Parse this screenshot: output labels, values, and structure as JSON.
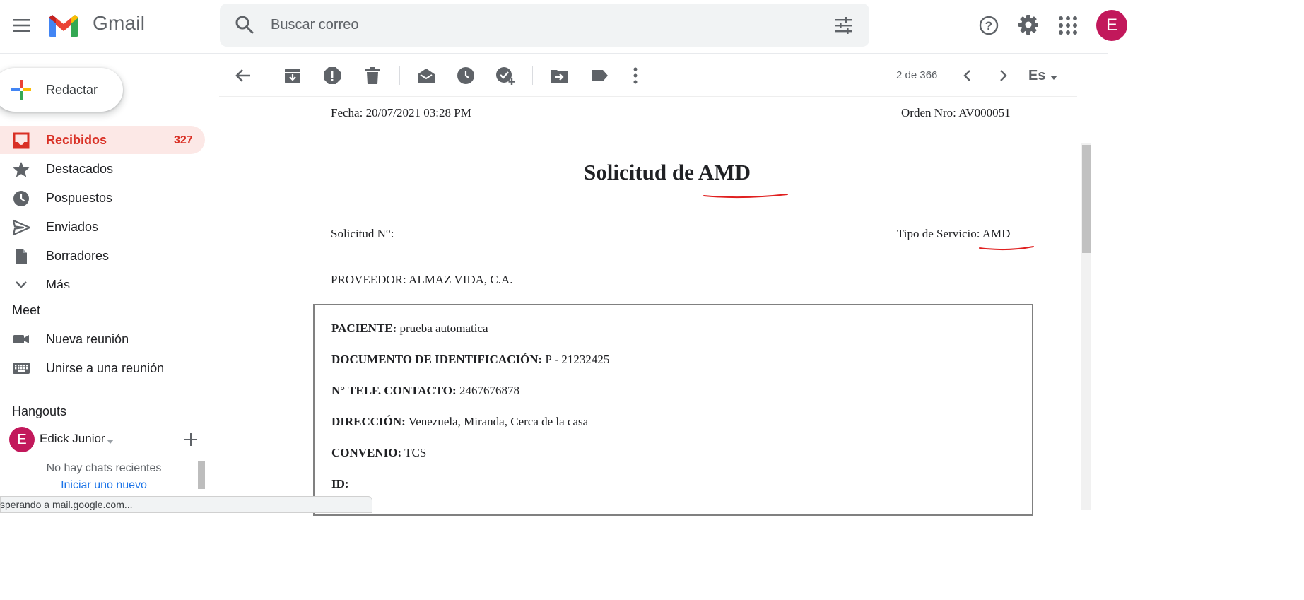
{
  "header": {
    "app_name": "Gmail",
    "search_placeholder": "Buscar correo",
    "avatar_letter": "E"
  },
  "sidebar": {
    "compose_label": "Redactar",
    "items": [
      {
        "label": "Recibidos",
        "count": "327",
        "icon": "inbox-icon",
        "active": true
      },
      {
        "label": "Destacados",
        "icon": "star-icon"
      },
      {
        "label": "Pospuestos",
        "icon": "clock-icon"
      },
      {
        "label": "Enviados",
        "icon": "send-icon"
      },
      {
        "label": "Borradores",
        "icon": "draft-icon"
      },
      {
        "label": "Más",
        "icon": "chevron-down-icon"
      }
    ],
    "meet": {
      "title": "Meet",
      "new_meeting": "Nueva reunión",
      "join_meeting": "Unirse a una reunión"
    },
    "hangouts": {
      "title": "Hangouts",
      "user_initial": "E",
      "user_name": "Edick Junior",
      "no_chats": "No hay chats recientes",
      "start_new": "Iniciar uno nuevo"
    }
  },
  "toolbar": {
    "icons": [
      "back-arrow-icon",
      "archive-icon",
      "report-spam-icon",
      "delete-icon",
      "mark-unread-icon",
      "snooze-icon",
      "add-task-icon",
      "move-to-icon",
      "label-icon",
      "more-vert-icon"
    ],
    "pager": "2 de 366",
    "language": "Es"
  },
  "status_bar": {
    "text": "sperando a mail.google.com..."
  },
  "document": {
    "fecha": "Fecha: 20/07/2021 03:28 PM",
    "orden": "Orden Nro: AV000051",
    "title": "Solicitud de AMD",
    "solicitud_no": "Solicitud N°:",
    "tipo_servicio": "Tipo de Servicio: AMD",
    "proveedor": "PROVEEDOR: ALMAZ VIDA, C.A.",
    "fields": [
      {
        "label": "PACIENTE:",
        "value": "prueba automatica"
      },
      {
        "label": "DOCUMENTO DE IDENTIFICACIÓN:",
        "value": "P - 21232425"
      },
      {
        "label": "N° TELF. CONTACTO:",
        "value": "2467676878"
      },
      {
        "label": "DIRECCIÓN:",
        "value": "Venezuela, Miranda, Cerca de la casa"
      },
      {
        "label": "CONVENIO:",
        "value": "TCS"
      },
      {
        "label": "ID:",
        "value": ""
      }
    ]
  },
  "colors": {
    "accent_red": "#d93025",
    "active_bg": "#fce8e6",
    "annotation_red": "#e02020",
    "avatar": "#c2185b"
  }
}
